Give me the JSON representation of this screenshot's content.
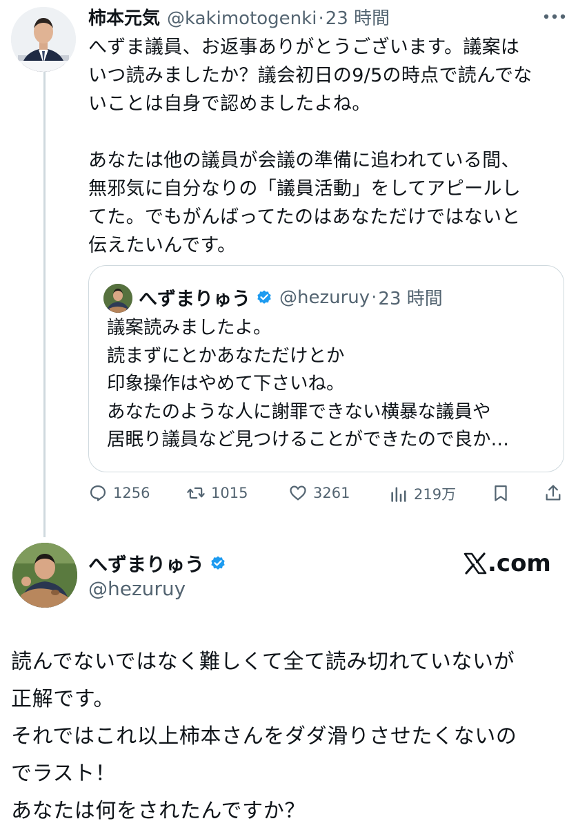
{
  "tweet1": {
    "author_name": "柿本元気",
    "handle": "@kakimotogenki",
    "time_sep": "·",
    "time": "23 時間",
    "body_lines": [
      "へずま議員、お返事ありがとうございます。議案は",
      "いつ読みましたか？議会初日の9/5の時点で読んでな",
      "いことは自身で認めましたよね。",
      "",
      "あなたは他の議員が会議の準備に追われている間、",
      "無邪気に自分なりの「議員活動」をしてアピールし",
      "てた。でもがんばってたのはあなただけではないと",
      "伝えたいんです。"
    ],
    "more_icon": "more-dots-icon"
  },
  "quoted": {
    "author_name": "へずまりゅう",
    "handle": "@hezuruy",
    "time_sep": "·",
    "time": "23 時間",
    "verified_color": "#1d9bf0",
    "body_lines": [
      "議案読みましたよ。",
      "読まずにとかあなただけとか",
      "印象操作はやめて下さいね。",
      "あなたのような人に謝罪できない横暴な議員や",
      "居眠り議員など見つけることができたので良か…"
    ]
  },
  "actions": {
    "replies": "1256",
    "reposts": "1015",
    "likes": "3261",
    "views": "219万"
  },
  "tweet2": {
    "author_name": "へずまりゅう",
    "handle": "@hezuruy",
    "brand": ".com",
    "body_lines": [
      "読んでないではなく難しくて全て読み切れていないが",
      "正解です。",
      "それではこれ以上柿本さんをダダ滑りさせたくないの",
      "でラスト！",
      "あなたは何をされたんですか？"
    ]
  },
  "colors": {
    "text": "#0f1419",
    "secondary": "#536471",
    "border": "#cfd9de",
    "verified": "#1d9bf0"
  }
}
